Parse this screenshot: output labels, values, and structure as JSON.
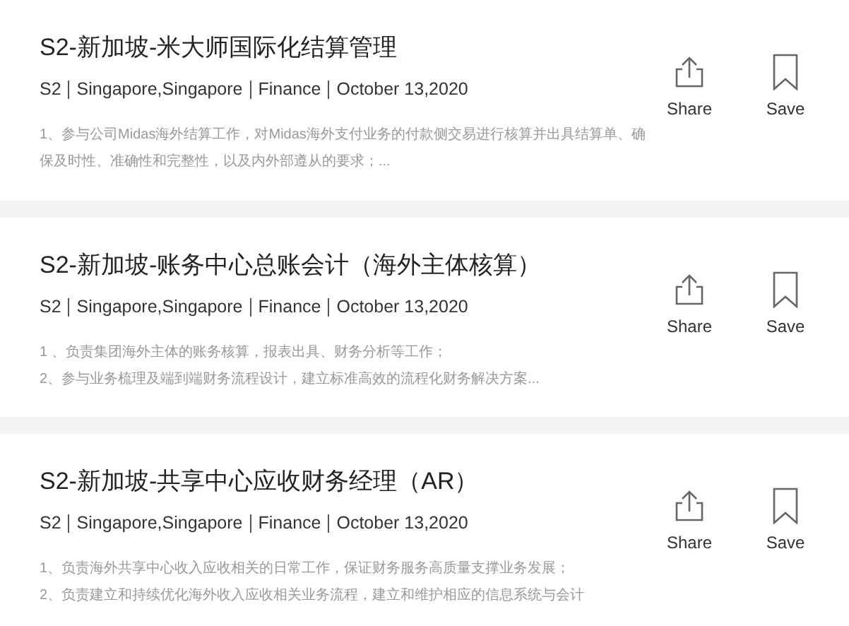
{
  "jobs": [
    {
      "title": "S2-新加坡-米大师国际化结算管理",
      "meta": [
        "S2",
        "Singapore,Singapore",
        "Finance",
        "October 13,2020"
      ],
      "description": [
        "1、参与公司Midas海外结算工作，对Midas海外支付业务的付款侧交易进行核算并出具结算单、确保及时性、准确性和完整性，以及内外部遵从的要求；..."
      ],
      "actions": [
        {
          "kind": "share",
          "label": "Share"
        },
        {
          "kind": "save",
          "label": "Save"
        }
      ]
    },
    {
      "title": "S2-新加坡-账务中心总账会计（海外主体核算）",
      "meta": [
        "S2",
        "Singapore,Singapore",
        "Finance",
        "October 13,2020"
      ],
      "description": [
        "1 、负责集团海外主体的账务核算，报表出具、财务分析等工作；",
        "2、参与业务梳理及端到端财务流程设计，建立标准高效的流程化财务解决方案..."
      ],
      "actions": [
        {
          "kind": "share",
          "label": "Share"
        },
        {
          "kind": "save",
          "label": "Save"
        }
      ]
    },
    {
      "title": "S2-新加坡-共享中心应收财务经理（AR）",
      "meta": [
        "S2",
        "Singapore,Singapore",
        "Finance",
        "October 13,2020"
      ],
      "description": [
        "1、负责海外共享中心收入应收相关的日常工作，保证财务服务高质量支撑业务发展；",
        "2、负责建立和持续优化海外收入应收相关业务流程，建立和维护相应的信息系统与会计"
      ],
      "actions": [
        {
          "kind": "share",
          "label": "Share"
        },
        {
          "kind": "save",
          "label": "Save"
        }
      ]
    }
  ]
}
